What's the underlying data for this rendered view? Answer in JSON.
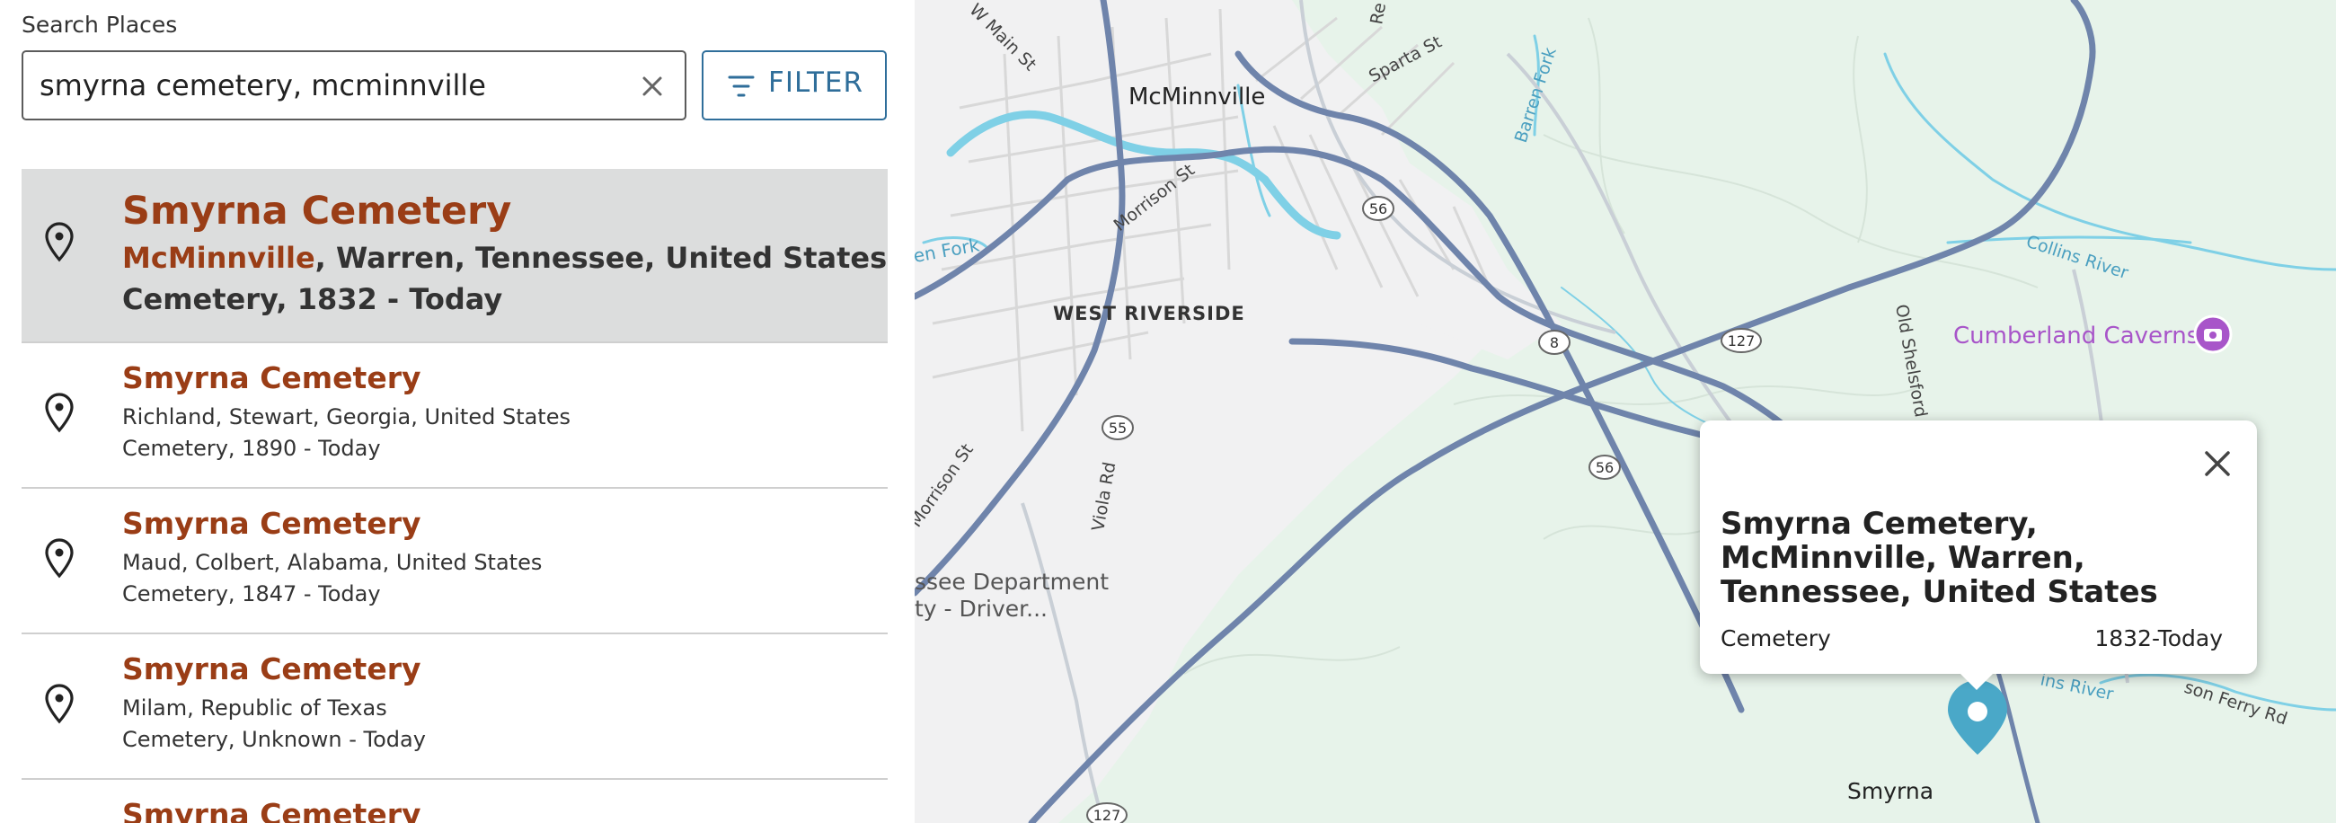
{
  "search": {
    "label": "Search Places",
    "value": "smyrna cemetery, mcminnville",
    "filter_label": "FILTER"
  },
  "results": [
    {
      "title": "Smyrna Cemetery",
      "place_highlight": "McMinnville",
      "place_rest": ", Warren, Tennessee, United States",
      "meta": "Cemetery, 1832 - Today",
      "selected": true
    },
    {
      "title": "Smyrna Cemetery",
      "place": "Richland, Stewart, Georgia, United States",
      "meta": "Cemetery, 1890 - Today"
    },
    {
      "title": "Smyrna Cemetery",
      "place": "Maud, Colbert, Alabama, United States",
      "meta": "Cemetery, 1847 - Today"
    },
    {
      "title": "Smyrna Cemetery",
      "place": "Milam, Republic of Texas",
      "meta": "Cemetery, Unknown - Today"
    },
    {
      "title": "Smyrna Cemetery"
    }
  ],
  "map": {
    "labels": {
      "mcminnville": "McMinnville",
      "west_riverside": "WEST RIVERSIDE",
      "smyrna": "Smyrna",
      "w_main_st": "W Main St",
      "sparta_st": "Sparta St",
      "barren_fork": "Barren Fork",
      "morrison_st": "Morrison St",
      "morrison_st_2": "Morrison St",
      "viola_rd": "Viola Rd",
      "old_shelsford": "Old Shelsford",
      "collins_river": "Collins River",
      "collins_river_2": "ins River",
      "en_fork": "en Fork",
      "dept_1": "ssee Department",
      "dept_2": "ty - Driver...",
      "son_ferry": "son Ferry Rd",
      "re_top": "Re",
      "poi": "Cumberland Caverns"
    },
    "shields": {
      "s56a": "56",
      "s8": "8",
      "s127a": "127",
      "s55": "55",
      "s56b": "56",
      "s127b": "127",
      "s56c": "56"
    },
    "colors": {
      "land": "#e7f3ea",
      "town": "#f1f1f1",
      "water": "#7fd0e6",
      "highway": "#7c8fb3",
      "marker": "#4aa8c8",
      "poi": "#a855c9"
    }
  },
  "popup": {
    "title": "Smyrna Cemetery, McMinnville, Warren, Tennessee, United States",
    "type": "Cemetery",
    "dates": "1832-Today"
  }
}
